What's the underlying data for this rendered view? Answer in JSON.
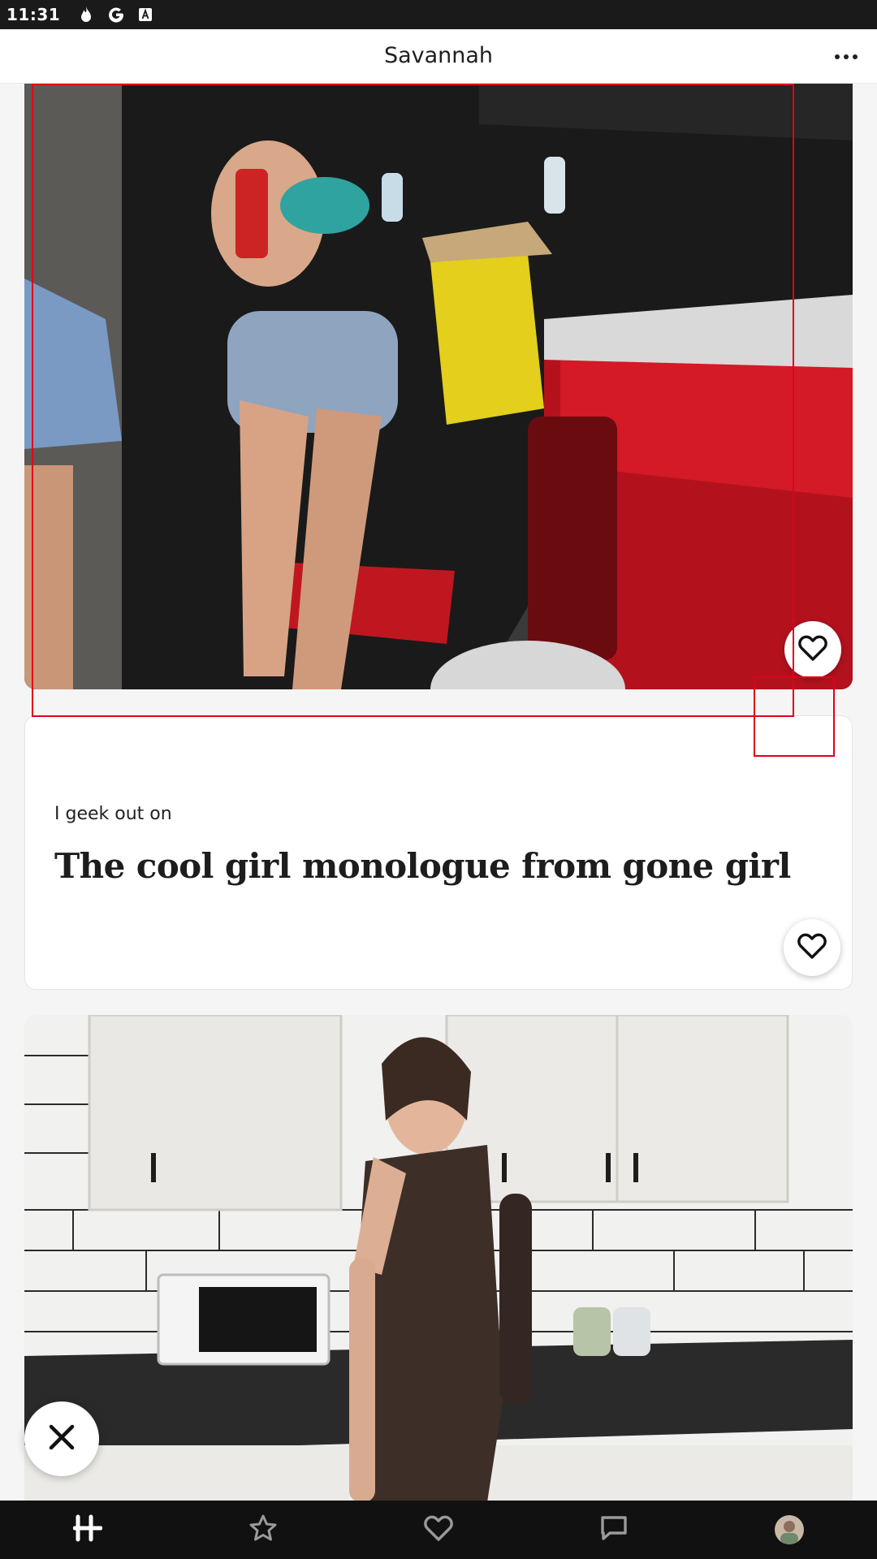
{
  "status_bar": {
    "time": "11:31",
    "icons": [
      "flame-icon",
      "google-icon",
      "keyboard-a-icon"
    ]
  },
  "header": {
    "title": "Savannah",
    "more_icon": "more-horizontal-icon"
  },
  "feed": {
    "photo_1": {
      "like_icon": "heart-icon"
    },
    "prompt": {
      "question": "I geek out on",
      "answer": "The cool girl monologue from gone girl",
      "like_icon": "heart-icon"
    },
    "photo_2": {}
  },
  "skip_button": {
    "icon": "close-x-icon"
  },
  "bottom_nav": {
    "items": [
      {
        "icon": "hinge-logo-icon",
        "active": true
      },
      {
        "icon": "star-icon",
        "active": false
      },
      {
        "icon": "heart-icon",
        "active": false
      },
      {
        "icon": "chat-bubble-icon",
        "active": false
      },
      {
        "icon": "profile-avatar",
        "active": false
      }
    ]
  },
  "colors": {
    "overlay_red": "#e0001b",
    "nav_background": "#111111",
    "status_background": "#1a1a1a"
  }
}
